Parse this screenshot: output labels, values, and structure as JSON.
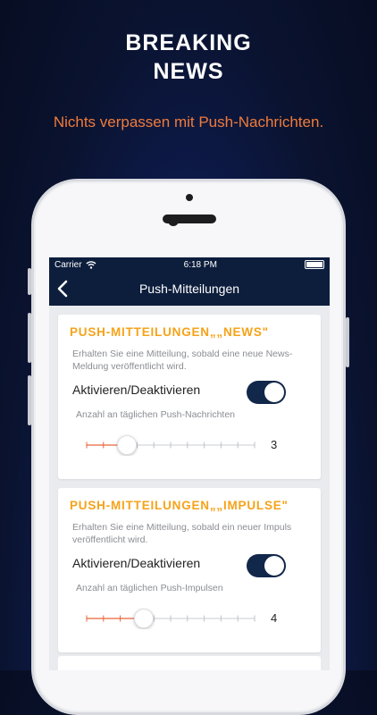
{
  "promo": {
    "headline_line1": "BREAKING",
    "headline_line2": "NEWS",
    "subline": "Nichts verpassen mit Push-Nachrichten."
  },
  "statusbar": {
    "carrier": "Carrier",
    "time": "6:18 PM"
  },
  "navbar": {
    "title": "Push-Mitteilungen",
    "back_icon": "chevron-left-icon"
  },
  "sections": [
    {
      "title": "PUSH-MITTEILUNGEN„„NEWS\"",
      "description": "Erhalten Sie eine Mitteilung, sobald eine neue News-Meldung veröffentlicht wird.",
      "toggle_label": "Aktivieren/Deaktivieren",
      "toggle_on": true,
      "count_label": "Anzahl an täglichen Push-Nachrichten",
      "slider_value": "3",
      "slider_level": 3
    },
    {
      "title": "PUSH-MITTEILUNGEN„„IMPULSE\"",
      "description": "Erhalten Sie eine Mitteilung, sobald ein neuer Impuls veröffentlicht wird.",
      "toggle_label": "Aktivieren/Deaktivieren",
      "toggle_on": true,
      "count_label": "Anzahl an täglichen Push-Impulsen",
      "slider_value": "4",
      "slider_level": 4
    }
  ],
  "colors": {
    "accent": "#f5a31a",
    "subline": "#f07b3b",
    "navbar": "#0d1e3d",
    "toggle": "#12284a",
    "slider_active": "#e8663a"
  }
}
